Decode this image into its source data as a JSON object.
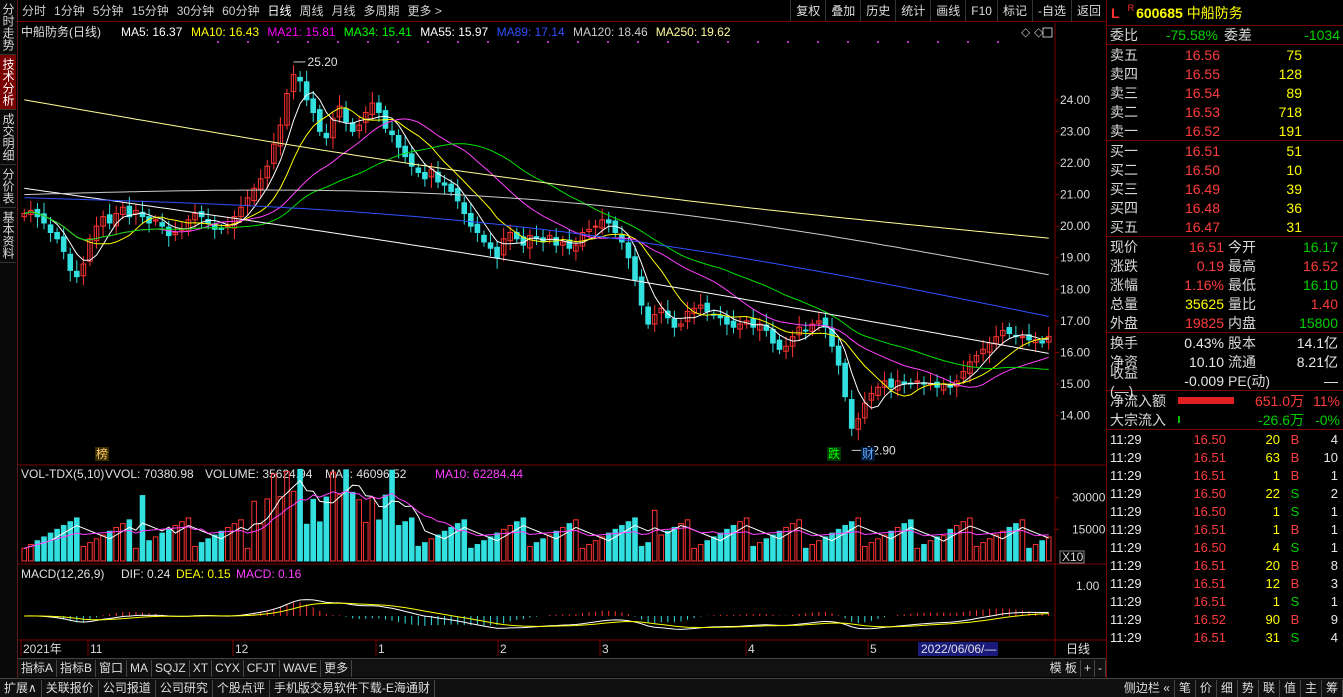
{
  "left_tabs": [
    "分时走势",
    "技术分析",
    "成交明细",
    "分价表",
    "基本资料"
  ],
  "periods": [
    "分时",
    "1分钟",
    "5分钟",
    "15分钟",
    "30分钟",
    "60分钟",
    "日线",
    "周线",
    "月线",
    "多周期",
    "更多 >"
  ],
  "selected_period": "日线",
  "tools": [
    "复权",
    "叠加",
    "历史",
    "统计",
    "画线",
    "F10",
    "标记",
    "-自选",
    "返回"
  ],
  "ma_line": {
    "title": "中船防务(日线)",
    "items": [
      {
        "label": "MA5: 16.37",
        "color": "#ffffff"
      },
      {
        "label": "MA10: 16.43",
        "color": "#ffff00"
      },
      {
        "label": "MA21: 15.81",
        "color": "#ff00ff"
      },
      {
        "label": "MA34: 15.41",
        "color": "#00ff00"
      },
      {
        "label": "MA55: 15.97",
        "color": "#ffffff"
      },
      {
        "label": "MA89: 17.14",
        "color": "#3050ff"
      },
      {
        "label": "MA120: 18.46",
        "color": "#cccccc"
      },
      {
        "label": "MA250: 19.62",
        "color": "#ffff99"
      }
    ]
  },
  "price_axis": [
    "24.00",
    "23.00",
    "22.00",
    "21.00",
    "20.00",
    "19.00",
    "18.00",
    "17.00",
    "16.00",
    "15.00",
    "14.00"
  ],
  "high_label": "25.20",
  "low_label": "12.90",
  "markers": [
    "榜",
    "跌",
    "财"
  ],
  "vol_line": {
    "title": "VOL-TDX(5,10)",
    "vvol": "VVOL: 70380.98",
    "volume": "VOLUME: 35624.94",
    "ma5": "MA5: 46096.52",
    "ma10": "MA10: 62284.44"
  },
  "vol_axis": [
    "30000",
    "15000"
  ],
  "vol_unit": "X10",
  "macd_line": {
    "title": "MACD(12,26,9)",
    "dif": "DIF: 0.24",
    "dea": "DEA: 0.15",
    "macd": "MACD: 0.16"
  },
  "macd_axis": [
    "1.00"
  ],
  "time_axis": [
    "2021年",
    "11",
    "12",
    "1",
    "2",
    "3",
    "4",
    "5"
  ],
  "date_box": "2022/06/06/—",
  "period_label": "日线",
  "bottom_tabs": [
    "指标A",
    "指标B",
    "窗口",
    "MA",
    "SQJZ",
    "XT",
    "CYX",
    "CFJT",
    "WAVE",
    "更多"
  ],
  "bottom_right": [
    "模 板",
    "+",
    "-"
  ],
  "status_tabs": [
    "扩展∧",
    "关联报价",
    "公司报道",
    "公司研究",
    "个股点评",
    "手机版交易软件下载-E海通财"
  ],
  "status_right": [
    "侧边栏 «",
    "笔",
    "价",
    "细",
    "势",
    "联",
    "值",
    "主",
    "筹"
  ],
  "quote": {
    "market": "L",
    "flag": "R",
    "code": "600685",
    "name": "中船防务",
    "weibi_label": "委比",
    "weibi": "-75.58%",
    "weicha_label": "委差",
    "weicha": "-1034",
    "asks": [
      {
        "label": "卖五",
        "price": "16.56",
        "vol": "75"
      },
      {
        "label": "卖四",
        "price": "16.55",
        "vol": "128"
      },
      {
        "label": "卖三",
        "price": "16.54",
        "vol": "89"
      },
      {
        "label": "卖二",
        "price": "16.53",
        "vol": "718"
      },
      {
        "label": "卖一",
        "price": "16.52",
        "vol": "191"
      }
    ],
    "bids": [
      {
        "label": "买一",
        "price": "16.51",
        "vol": "51"
      },
      {
        "label": "买二",
        "price": "16.50",
        "vol": "10"
      },
      {
        "label": "买三",
        "price": "16.49",
        "vol": "39"
      },
      {
        "label": "买四",
        "price": "16.48",
        "vol": "36"
      },
      {
        "label": "买五",
        "price": "16.47",
        "vol": "31"
      }
    ],
    "stats": [
      {
        "l1": "现价",
        "v1": "16.51",
        "c1": "red",
        "l2": "今开",
        "v2": "16.17",
        "c2": "green"
      },
      {
        "l1": "涨跌",
        "v1": "0.19",
        "c1": "red",
        "l2": "最高",
        "v2": "16.52",
        "c2": "red"
      },
      {
        "l1": "涨幅",
        "v1": "1.16%",
        "c1": "red",
        "l2": "最低",
        "v2": "16.10",
        "c2": "green"
      },
      {
        "l1": "总量",
        "v1": "35625",
        "c1": "yellow",
        "l2": "量比",
        "v2": "1.40",
        "c2": "red"
      },
      {
        "l1": "外盘",
        "v1": "19825",
        "c1": "red",
        "l2": "内盘",
        "v2": "15800",
        "c2": "green"
      }
    ],
    "stats2": [
      {
        "l1": "换手",
        "v1": "0.43%",
        "l2": "股本",
        "v2": "14.1亿"
      },
      {
        "l1": "净资",
        "v1": "10.10",
        "l2": "流通",
        "v2": "8.21亿"
      },
      {
        "l1": "收益(—)",
        "v1": "-0.009",
        "l2": "PE(动)",
        "v2": "—"
      }
    ],
    "flow": [
      {
        "label": "净流入额",
        "value": "651.0万",
        "pct": "11%",
        "color": "red",
        "bar": 0.7
      },
      {
        "label": "大宗流入",
        "value": "-26.6万",
        "pct": "-0%",
        "color": "green",
        "bar": 0.02
      }
    ],
    "ticks": [
      {
        "t": "11:29",
        "p": "16.50",
        "v": "20",
        "s": "B",
        "n": "4",
        "pc": "red",
        "sc": "red"
      },
      {
        "t": "11:29",
        "p": "16.51",
        "v": "63",
        "s": "B",
        "n": "10",
        "pc": "red",
        "sc": "red"
      },
      {
        "t": "11:29",
        "p": "16.51",
        "v": "1",
        "s": "B",
        "n": "1",
        "pc": "red",
        "sc": "red"
      },
      {
        "t": "11:29",
        "p": "16.50",
        "v": "22",
        "s": "S",
        "n": "2",
        "pc": "red",
        "sc": "green"
      },
      {
        "t": "11:29",
        "p": "16.50",
        "v": "1",
        "s": "S",
        "n": "1",
        "pc": "red",
        "sc": "green"
      },
      {
        "t": "11:29",
        "p": "16.51",
        "v": "1",
        "s": "B",
        "n": "1",
        "pc": "red",
        "sc": "red"
      },
      {
        "t": "11:29",
        "p": "16.50",
        "v": "4",
        "s": "S",
        "n": "1",
        "pc": "red",
        "sc": "green"
      },
      {
        "t": "11:29",
        "p": "16.51",
        "v": "20",
        "s": "B",
        "n": "8",
        "pc": "red",
        "sc": "red"
      },
      {
        "t": "11:29",
        "p": "16.51",
        "v": "12",
        "s": "B",
        "n": "3",
        "pc": "red",
        "sc": "red"
      },
      {
        "t": "11:29",
        "p": "16.51",
        "v": "1",
        "s": "S",
        "n": "1",
        "pc": "red",
        "sc": "green"
      },
      {
        "t": "11:29",
        "p": "16.52",
        "v": "90",
        "s": "B",
        "n": "9",
        "pc": "red",
        "sc": "red"
      },
      {
        "t": "11:29",
        "p": "16.51",
        "v": "31",
        "s": "S",
        "n": "4",
        "pc": "red",
        "sc": "green"
      }
    ]
  },
  "chart_data": {
    "type": "candlestick",
    "ylim": [
      12.5,
      25.8
    ],
    "closes": [
      20.4,
      20.5,
      20.3,
      20.1,
      19.8,
      19.6,
      19.2,
      18.6,
      18.4,
      18.8,
      19.6,
      20.0,
      20.3,
      20.1,
      20.4,
      20.6,
      20.3,
      20.5,
      20.3,
      20.1,
      20.2,
      20.0,
      19.7,
      19.8,
      19.9,
      20.2,
      20.4,
      20.3,
      20.1,
      19.9,
      19.9,
      20.0,
      20.3,
      20.6,
      20.9,
      21.2,
      21.5,
      21.9,
      22.6,
      23.2,
      24.2,
      24.8,
      24.6,
      24.0,
      23.6,
      23.0,
      22.8,
      23.4,
      23.8,
      23.3,
      23.0,
      23.2,
      23.6,
      23.9,
      23.6,
      23.1,
      22.9,
      22.5,
      22.2,
      21.9,
      21.7,
      21.5,
      21.8,
      21.4,
      21.3,
      21.1,
      20.8,
      20.4,
      20.0,
      19.8,
      19.5,
      19.3,
      19.0,
      19.6,
      19.8,
      19.6,
      19.4,
      19.7,
      19.6,
      19.5,
      19.7,
      19.4,
      19.5,
      19.3,
      19.4,
      19.8,
      19.9,
      20.0,
      20.2,
      20.1,
      19.8,
      19.5,
      19.0,
      18.3,
      17.5,
      16.9,
      17.2,
      17.4,
      17.1,
      16.8,
      16.9,
      17.3,
      17.4,
      17.5,
      17.3,
      17.2,
      17.1,
      16.9,
      16.8,
      16.9,
      17.0,
      16.8,
      16.9,
      16.7,
      16.3,
      16.1,
      16.2,
      16.5,
      16.8,
      16.7,
      16.9,
      17.0,
      16.8,
      16.2,
      15.6,
      14.6,
      13.6,
      13.9,
      14.4,
      14.7,
      14.9,
      15.1,
      14.9,
      15.1,
      15.0,
      15.0,
      15.1,
      15.0,
      15.0,
      14.9,
      15.0,
      14.9,
      15.1,
      15.4,
      15.7,
      15.9,
      16.1,
      16.3,
      16.5,
      16.7,
      16.6,
      16.5,
      16.5,
      16.4,
      16.4,
      16.3,
      16.51
    ],
    "ma5": 16.37,
    "ma10": 16.43,
    "ma21": 15.81,
    "ma34": 15.41,
    "ma55": 15.97,
    "ma89": 17.14,
    "ma120": 18.46,
    "ma250": 19.62,
    "volume_ylim": [
      0,
      36000
    ],
    "macd": {
      "dif": 0.24,
      "dea": 0.15,
      "macd": 0.16
    }
  }
}
